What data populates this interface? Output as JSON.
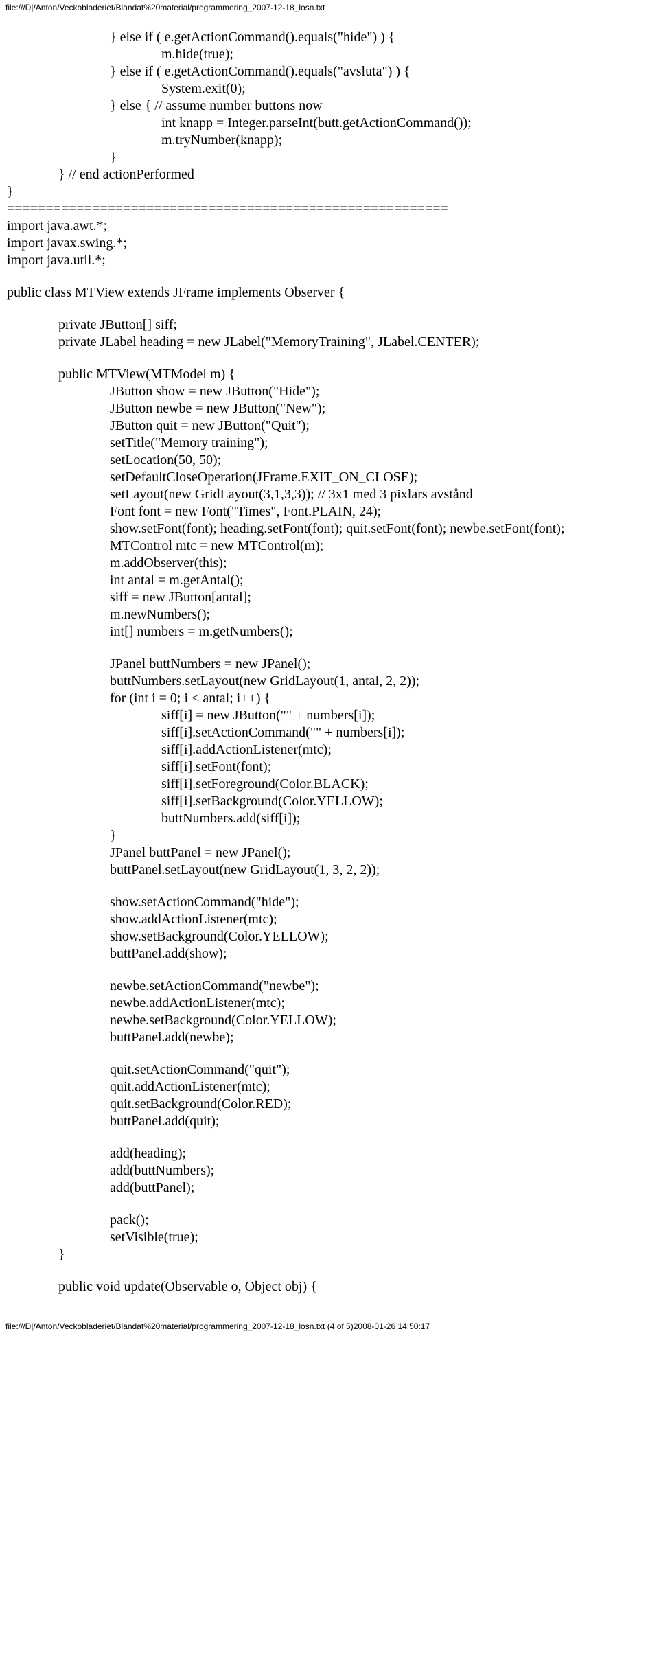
{
  "header": {
    "path": "file:///D|/Anton/Veckobladeriet/Blandat%20material/programmering_2007-12-18_losn.txt"
  },
  "footer": {
    "path": "file:///D|/Anton/Veckobladeriet/Blandat%20material/programmering_2007-12-18_losn.txt (4 of 5)2008-01-26 14:50:17"
  },
  "code": {
    "l1": "} else if (     e.getActionCommand().equals(\"hide\") ) {",
    "l2": "m.hide(true);",
    "l3": "} else if (     e.getActionCommand().equals(\"avsluta\") ) {",
    "l4": "System.exit(0);",
    "l5": "} else { // assume number buttons now",
    "l6": "int knapp = Integer.parseInt(butt.getActionCommand());",
    "l7": "m.tryNumber(knapp);",
    "l8": "}",
    "l9": "} // end actionPerformed",
    "l10": "}",
    "l11": "=========================================================",
    "l12": "import java.awt.*;",
    "l13": "import javax.swing.*;",
    "l14": "import java.util.*;",
    "l15": "public class MTView extends JFrame implements Observer {",
    "l16": "private JButton[] siff;",
    "l17": "private JLabel  heading = new JLabel(\"MemoryTraining\", JLabel.CENTER);",
    "l18": "public MTView(MTModel m) {",
    "l19": "JButton show = new JButton(\"Hide\");",
    "l20": "JButton newbe = new JButton(\"New\");",
    "l21": "JButton quit = new JButton(\"Quit\");",
    "l22": "setTitle(\"Memory training\");",
    "l23": "setLocation(50, 50);",
    "l24": "setDefaultCloseOperation(JFrame.EXIT_ON_CLOSE);",
    "l25": "setLayout(new GridLayout(3,1,3,3)); // 3x1 med 3 pixlars avstånd",
    "l26": "Font font = new Font(\"Times\", Font.PLAIN, 24);",
    "l27": "show.setFont(font); heading.setFont(font); quit.setFont(font); newbe.setFont(font);",
    "l28": "MTControl mtc = new MTControl(m);",
    "l29": "m.addObserver(this);",
    "l30": "int antal = m.getAntal();",
    "l31": "siff = new JButton[antal];",
    "l32": "m.newNumbers();",
    "l33": "int[] numbers = m.getNumbers();",
    "l34": "JPanel buttNumbers = new JPanel();",
    "l35": "buttNumbers.setLayout(new GridLayout(1, antal, 2, 2));",
    "l36": "for (int i = 0; i < antal; i++) {",
    "l37": "siff[i] = new JButton(\"\" + numbers[i]);",
    "l38": "siff[i].setActionCommand(\"\" + numbers[i]);",
    "l39": "siff[i].addActionListener(mtc);",
    "l40": "siff[i].setFont(font);",
    "l41": "siff[i].setForeground(Color.BLACK);",
    "l42": "siff[i].setBackground(Color.YELLOW);",
    "l43": "buttNumbers.add(siff[i]);",
    "l44": "}",
    "l45": "JPanel buttPanel = new JPanel();",
    "l46": "buttPanel.setLayout(new GridLayout(1, 3, 2, 2));",
    "l47": "show.setActionCommand(\"hide\");",
    "l48": "show.addActionListener(mtc);",
    "l49": "show.setBackground(Color.YELLOW);",
    "l50": "buttPanel.add(show);",
    "l51": "newbe.setActionCommand(\"newbe\");",
    "l52": "newbe.addActionListener(mtc);",
    "l53": "newbe.setBackground(Color.YELLOW);",
    "l54": "buttPanel.add(newbe);",
    "l55": "quit.setActionCommand(\"quit\");",
    "l56": "quit.addActionListener(mtc);",
    "l57": "quit.setBackground(Color.RED);",
    "l58": "buttPanel.add(quit);",
    "l59": "add(heading);",
    "l60": "add(buttNumbers);",
    "l61": "add(buttPanel);",
    "l62": "pack();",
    "l63": "setVisible(true);",
    "l64": "}",
    "l65": "public void update(Observable o, Object obj) {"
  }
}
